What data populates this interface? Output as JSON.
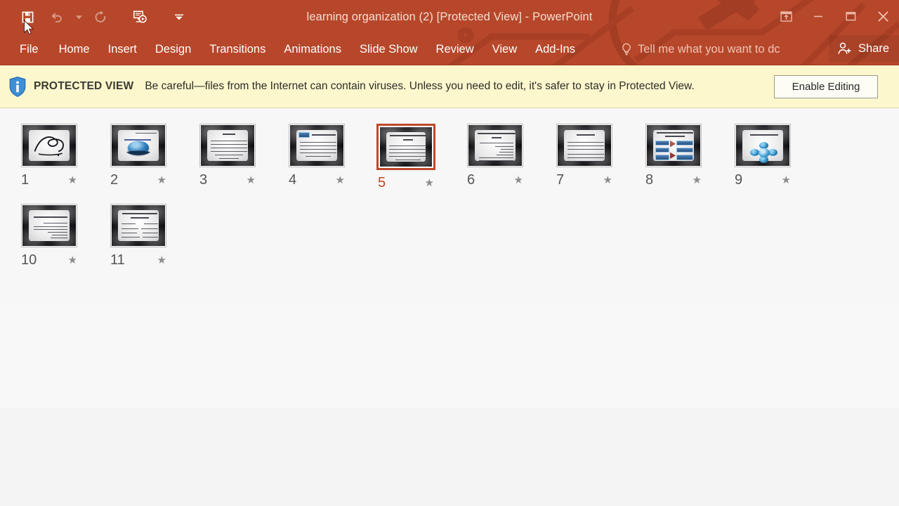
{
  "window": {
    "title": "learning organization (2) [Protected View] - PowerPoint",
    "accent_color": "#b7472a",
    "quick_access": [
      {
        "name": "save-icon",
        "label": "Save",
        "state": "enabled"
      },
      {
        "name": "undo-icon",
        "label": "Undo",
        "state": "disabled"
      },
      {
        "name": "undo-dropdown-icon",
        "label": "Undo options",
        "state": "disabled"
      },
      {
        "name": "redo-icon",
        "label": "Redo",
        "state": "disabled"
      },
      {
        "name": "start-slideshow-icon",
        "label": "Start From Beginning",
        "state": "enabled"
      },
      {
        "name": "customize-qat-icon",
        "label": "Customize Quick Access Toolbar",
        "state": "enabled"
      }
    ],
    "controls": [
      {
        "name": "ribbon-display-options-icon",
        "label": "Ribbon Display Options"
      },
      {
        "name": "minimize-icon",
        "label": "Minimize"
      },
      {
        "name": "maximize-icon",
        "label": "Restore Down"
      },
      {
        "name": "close-icon",
        "label": "Close"
      }
    ]
  },
  "ribbon": {
    "tabs": [
      {
        "label": "File",
        "id": "file"
      },
      {
        "label": "Home",
        "id": "home"
      },
      {
        "label": "Insert",
        "id": "insert"
      },
      {
        "label": "Design",
        "id": "design"
      },
      {
        "label": "Transitions",
        "id": "transitions"
      },
      {
        "label": "Animations",
        "id": "animations"
      },
      {
        "label": "Slide Show",
        "id": "slide-show"
      },
      {
        "label": "Review",
        "id": "review"
      },
      {
        "label": "View",
        "id": "view"
      },
      {
        "label": "Add-Ins",
        "id": "add-ins"
      }
    ],
    "tell_me": "Tell me what you want to dc",
    "share_label": "Share"
  },
  "protected_view": {
    "badge": "PROTECTED VIEW",
    "message": "Be careful—files from the Internet can contain viruses. Unless you need to edit, it's safer to stay in Protected View.",
    "enable_button": "Enable Editing",
    "bar_color": "#fcf7cd"
  },
  "slides": {
    "selected": 5,
    "items": [
      {
        "number": "1",
        "star": "★",
        "kind": "calligraphy"
      },
      {
        "number": "2",
        "star": "★",
        "kind": "globe"
      },
      {
        "number": "3",
        "star": "★",
        "kind": "text"
      },
      {
        "number": "4",
        "star": "★",
        "kind": "text-blue-logo"
      },
      {
        "number": "5",
        "star": "★",
        "kind": "text"
      },
      {
        "number": "6",
        "star": "★",
        "kind": "text-list"
      },
      {
        "number": "7",
        "star": "★",
        "kind": "text"
      },
      {
        "number": "8",
        "star": "★",
        "kind": "diagram-boxes"
      },
      {
        "number": "9",
        "star": "★",
        "kind": "diagram-nodes"
      },
      {
        "number": "10",
        "star": "★",
        "kind": "text-list"
      },
      {
        "number": "11",
        "star": "★",
        "kind": "two-column"
      }
    ]
  }
}
